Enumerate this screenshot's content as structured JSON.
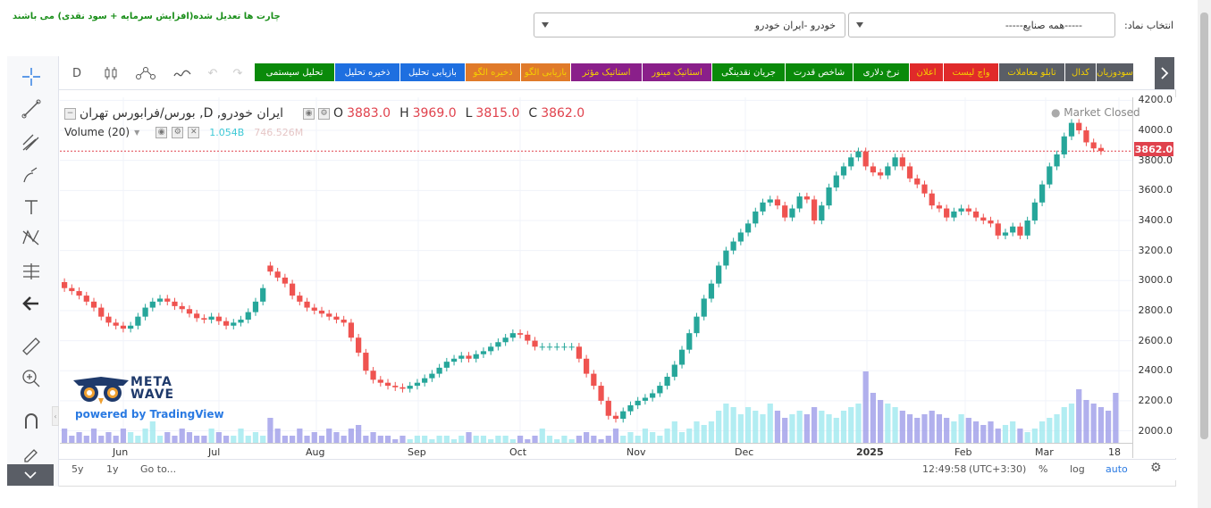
{
  "header": {
    "note": "چارت ها تعدیل شده(افزایش سرمایه + سود نقدی) می باشند",
    "symbol_label": "انتخاب نماد:",
    "industry_select": "-----همه صنایع-----",
    "symbol_select": "خودرو -ایران خودرو"
  },
  "toolbar": {
    "interval": "D",
    "chips": [
      {
        "label": "تحلیل سیستمی",
        "color": "#0a8a0a"
      },
      {
        "label": "ذخیره تحلیل",
        "color": "#1e6fe0"
      },
      {
        "label": "بازیابی تحلیل",
        "color": "#1e6fe0"
      },
      {
        "label": "ذخیره الگو",
        "color": "#e07a2a"
      },
      {
        "label": "بازیابی الگو",
        "color": "#e07a2a"
      },
      {
        "label": "استاتیک مؤثر",
        "color": "#8a1f8a"
      },
      {
        "label": "استاتیک مینور",
        "color": "#8a1f8a"
      },
      {
        "label": "جریان نقدینگی",
        "color": "#0a8a0a"
      },
      {
        "label": "شاخص قدرت",
        "color": "#0a8a0a"
      },
      {
        "label": "نرخ دلاری",
        "color": "#0a8a0a"
      },
      {
        "label": "اعلان",
        "color": "#e02a2a"
      },
      {
        "label": "واچ لیست",
        "color": "#e02a2a"
      },
      {
        "label": "تابلو معاملات",
        "color": "#5a5e66"
      },
      {
        "label": "کدال",
        "color": "#5a5e66"
      },
      {
        "label": "سودوزیان",
        "color": "#5a5e66"
      }
    ]
  },
  "legend": {
    "title": "ایران خودرو, D, بورس/فرابورس تهران",
    "o_label": "O",
    "o": "3883.0",
    "h_label": "H",
    "h": "3969.0",
    "l_label": "L",
    "l": "3815.0",
    "c_label": "C",
    "c": "3862.0",
    "volume_label": "Volume (20)",
    "vol1": "1.054B",
    "vol2": "746.526M",
    "market_status": "Market Closed"
  },
  "price_tag": "3862.0",
  "logo": {
    "text": "METAWAVE",
    "powered": "powered by TradingView"
  },
  "bottom": {
    "r5y": "5y",
    "r1y": "1y",
    "goto": "Go to...",
    "time": "12:49:58",
    "tz": "(UTC+3:30)",
    "pct": "%",
    "log": "log",
    "auto": "auto"
  },
  "chart_data": {
    "type": "candlestick",
    "y_ticks": [
      "4200.0",
      "4000.0",
      "3800.0",
      "3600.0",
      "3400.0",
      "3200.0",
      "3000.0",
      "2800.0",
      "2600.0",
      "2400.0",
      "2200.0",
      "2000.0"
    ],
    "ylim": [
      1920,
      4220
    ],
    "x_ticks": [
      "Jun",
      "Jul",
      "Aug",
      "Sep",
      "Oct",
      "Nov",
      "Dec",
      "2025",
      "Feb",
      "Mar",
      "18"
    ],
    "close_series": [
      2950,
      2930,
      2900,
      2860,
      2820,
      2760,
      2720,
      2700,
      2680,
      2700,
      2760,
      2820,
      2860,
      2880,
      2860,
      2830,
      2810,
      2780,
      2750,
      2740,
      2760,
      2730,
      2700,
      2720,
      2740,
      2790,
      2860,
      2950,
      3060,
      3020,
      2980,
      2900,
      2860,
      2820,
      2800,
      2780,
      2760,
      2740,
      2720,
      2620,
      2520,
      2400,
      2340,
      2320,
      2300,
      2290,
      2280,
      2300,
      2320,
      2350,
      2380,
      2420,
      2460,
      2480,
      2500,
      2480,
      2510,
      2530,
      2560,
      2590,
      2620,
      2650,
      2640,
      2600,
      2560,
      2560,
      2560,
      2560,
      2560,
      2560,
      2480,
      2380,
      2300,
      2200,
      2100,
      2080,
      2130,
      2170,
      2200,
      2220,
      2250,
      2300,
      2360,
      2440,
      2540,
      2650,
      2760,
      2880,
      2980,
      3100,
      3200,
      3260,
      3320,
      3380,
      3460,
      3520,
      3540,
      3500,
      3420,
      3480,
      3560,
      3540,
      3400,
      3500,
      3620,
      3700,
      3760,
      3820,
      3860,
      3760,
      3720,
      3700,
      3760,
      3820,
      3760,
      3680,
      3640,
      3580,
      3500,
      3480,
      3420,
      3460,
      3480,
      3460,
      3420,
      3400,
      3380,
      3300,
      3320,
      3360,
      3300,
      3400,
      3520,
      3640,
      3760,
      3840,
      3960,
      4050,
      4000,
      3920,
      3880,
      3862
    ],
    "open_series": [
      2990,
      2950,
      2930,
      2900,
      2860,
      2820,
      2760,
      2720,
      2700,
      2680,
      2700,
      2760,
      2820,
      2860,
      2880,
      2860,
      2830,
      2810,
      2780,
      2750,
      2740,
      2760,
      2730,
      2700,
      2720,
      2740,
      2790,
      2860,
      3100,
      3060,
      3020,
      2980,
      2900,
      2860,
      2820,
      2800,
      2780,
      2760,
      2740,
      2720,
      2620,
      2520,
      2400,
      2340,
      2320,
      2300,
      2290,
      2280,
      2300,
      2320,
      2350,
      2380,
      2420,
      2460,
      2480,
      2500,
      2480,
      2510,
      2530,
      2560,
      2590,
      2620,
      2650,
      2640,
      2600,
      2560,
      2560,
      2560,
      2560,
      2560,
      2560,
      2480,
      2380,
      2300,
      2200,
      2100,
      2080,
      2130,
      2170,
      2200,
      2220,
      2250,
      2300,
      2360,
      2440,
      2540,
      2650,
      2760,
      2880,
      2980,
      3100,
      3200,
      3260,
      3320,
      3380,
      3460,
      3520,
      3540,
      3500,
      3420,
      3480,
      3560,
      3540,
      3400,
      3500,
      3620,
      3700,
      3760,
      3820,
      3860,
      3760,
      3720,
      3700,
      3760,
      3820,
      3760,
      3680,
      3640,
      3580,
      3500,
      3480,
      3420,
      3460,
      3480,
      3460,
      3420,
      3400,
      3380,
      3300,
      3320,
      3360,
      3300,
      3400,
      3520,
      3640,
      3760,
      3840,
      3960,
      4050,
      4000,
      3920,
      3883
    ],
    "volume_series": [
      0.2,
      0.1,
      0.15,
      0.1,
      0.2,
      0.1,
      0.15,
      0.1,
      0.2,
      0.15,
      0.1,
      0.2,
      0.3,
      0.1,
      0.15,
      0.1,
      0.2,
      0.15,
      0.1,
      0.1,
      0.2,
      0.15,
      0.1,
      0.1,
      0.2,
      0.1,
      0.15,
      0.1,
      0.35,
      0.2,
      0.1,
      0.1,
      0.2,
      0.1,
      0.15,
      0.1,
      0.2,
      0.15,
      0.1,
      0.2,
      0.25,
      0.1,
      0.15,
      0.1,
      0.1,
      0.05,
      0.1,
      0.05,
      0.1,
      0.1,
      0.05,
      0.1,
      0.1,
      0.05,
      0.1,
      0.15,
      0.1,
      0.1,
      0.05,
      0.1,
      0.1,
      0.05,
      0.1,
      0.05,
      0.1,
      0.2,
      0.1,
      0.05,
      0.1,
      0.05,
      0.1,
      0.15,
      0.1,
      0.05,
      0.1,
      0.2,
      0.1,
      0.15,
      0.1,
      0.2,
      0.15,
      0.1,
      0.2,
      0.3,
      0.15,
      0.2,
      0.3,
      0.25,
      0.3,
      0.45,
      0.55,
      0.5,
      0.4,
      0.5,
      0.45,
      0.4,
      0.55,
      0.45,
      0.35,
      0.4,
      0.45,
      0.4,
      0.5,
      0.45,
      0.4,
      0.35,
      0.45,
      0.5,
      0.55,
      1.0,
      0.7,
      0.6,
      0.55,
      0.5,
      0.45,
      0.4,
      0.35,
      0.4,
      0.45,
      0.4,
      0.35,
      0.3,
      0.4,
      0.35,
      0.3,
      0.25,
      0.3,
      0.2,
      0.25,
      0.3,
      0.2,
      0.15,
      0.2,
      0.3,
      0.35,
      0.4,
      0.5,
      0.55,
      0.75,
      0.6,
      0.55,
      0.5,
      0.45,
      0.7
    ]
  }
}
